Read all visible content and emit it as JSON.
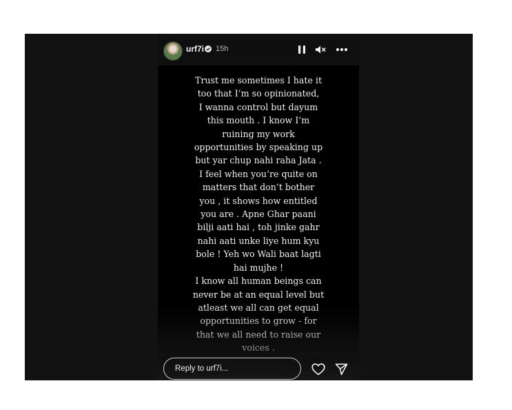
{
  "header": {
    "username": "urf7i",
    "time": "15h",
    "icons": {
      "verified": "verified-badge-icon",
      "pause": "pause-icon",
      "mute": "mute-icon",
      "more": "more-options-icon"
    }
  },
  "story": {
    "text": "Trust me sometimes I hate it\ntoo that I’m so opinionated,\nI wanna control but dayum\nthis mouth .  I know I’m\nruining my work\nopportunities by speaking up\nbut yar chup nahi raha Jata .\nI feel when you’re quite on\nmatters that don’t bother\nyou , it shows how entitled\nyou are . Apne Ghar paani\nbilji aati hai , toh jinke gahr\nnahi aati unke liye hum kyu\nbole ! Yeh wo Wali baat lagti\nhai mujhe !\nI know all human beings can\nnever be at an equal level but\natleast we all can get equal\nopportunities to grow - for\nthat we all need to raise our\nvoices ."
  },
  "footer": {
    "reply_placeholder": "Reply to urf7i...",
    "icons": {
      "like": "heart-icon",
      "share": "send-icon"
    }
  },
  "colors": {
    "story_background": "#000000",
    "frame_background": "#121212",
    "text": "#f2f2f2"
  }
}
